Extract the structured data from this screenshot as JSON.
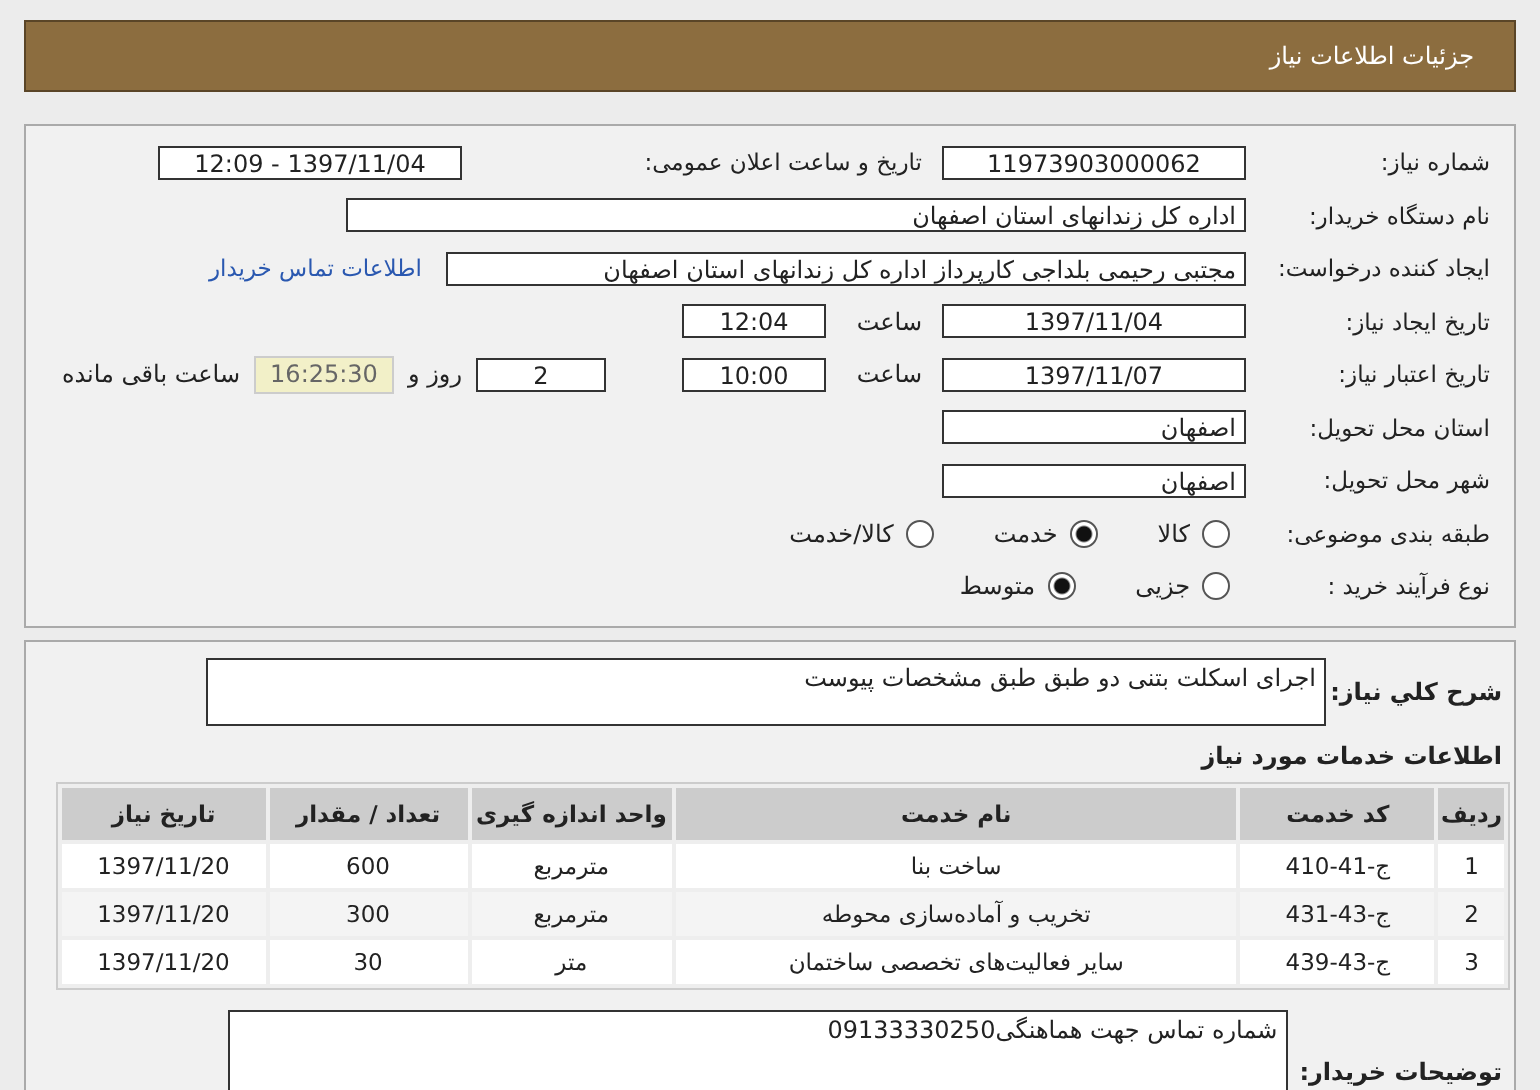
{
  "header": {
    "title": "جزئیات اطلاعات نیاز"
  },
  "details": {
    "need_number": {
      "label": "شماره نیاز:",
      "value": "11973903000062"
    },
    "announce": {
      "label": "تاریخ و ساعت اعلان عمومی:",
      "value": "1397/11/04 - 12:09"
    },
    "buyer_org": {
      "label": "نام دستگاه خریدار:",
      "value": "اداره کل زندانهای استان اصفهان"
    },
    "requester": {
      "label": "ایجاد کننده درخواست:",
      "value": "مجتبی رحیمی بلداجی کارپرداز اداره کل زندانهای استان اصفهان",
      "link": "اطلاعات تماس خریدار"
    },
    "created": {
      "label": "تاریخ ایجاد نیاز:",
      "date": "1397/11/04",
      "time_label": "ساعت",
      "time": "12:04"
    },
    "validity": {
      "label": "تاریخ اعتبار نیاز:",
      "date": "1397/11/07",
      "time_label": "ساعت",
      "time": "10:00",
      "days": "2",
      "days_label": "روز و",
      "remaining": "16:25:30",
      "remaining_label": "ساعت باقی مانده"
    },
    "province": {
      "label": "استان محل تحویل:",
      "value": "اصفهان"
    },
    "city": {
      "label": "شهر محل تحویل:",
      "value": "اصفهان"
    },
    "category": {
      "label": "طبقه بندی موضوعی:",
      "options": [
        {
          "label": "کالا",
          "selected": false
        },
        {
          "label": "خدمت",
          "selected": true
        },
        {
          "label": "کالا/خدمت",
          "selected": false
        }
      ]
    },
    "purchase_type": {
      "label": "نوع فرآیند خرید :",
      "options": [
        {
          "label": "جزیی",
          "selected": false
        },
        {
          "label": "متوسط",
          "selected": true
        }
      ]
    }
  },
  "description": {
    "label": "شرح کلي نياز:",
    "value": "اجرای اسکلت بتنی دو طبق طبق مشخصات پیوست"
  },
  "services": {
    "title": "اطلاعات خدمات مورد نیاز",
    "columns": [
      "ردیف",
      "کد خدمت",
      "نام خدمت",
      "واحد اندازه گیری",
      "تعداد / مقدار",
      "تاریخ نیاز"
    ],
    "rows": [
      [
        "1",
        "ج-41-410",
        "ساخت بنا",
        "مترمربع",
        "600",
        "1397/11/20"
      ],
      [
        "2",
        "ج-43-431",
        "تخریب و آماده‌سازی محوطه",
        "مترمربع",
        "300",
        "1397/11/20"
      ],
      [
        "3",
        "ج-43-439",
        "سایر فعالیت‌های تخصصی ساختمان",
        "متر",
        "30",
        "1397/11/20"
      ]
    ]
  },
  "buyer_notes": {
    "label": "توضیحات خریدار:",
    "value": "شماره تماس جهت هماهنگی09133330250"
  }
}
